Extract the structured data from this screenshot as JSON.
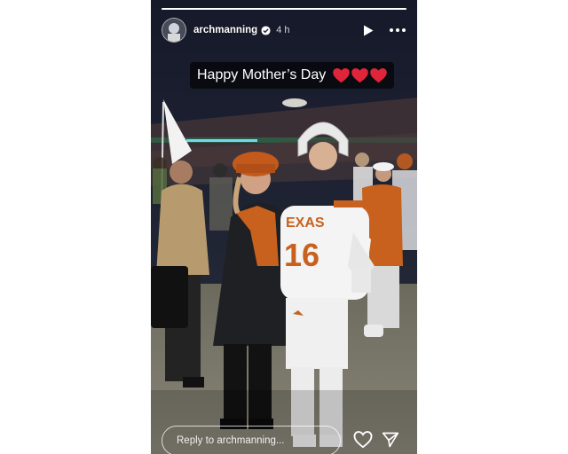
{
  "story": {
    "username": "archmanning",
    "time_ago": "4 h",
    "progress": 1.0,
    "caption": "Happy Mother’s Day",
    "heart_count": 3,
    "reply_placeholder": "Reply to archmanning...",
    "jersey_text": "EXAS",
    "jersey_number": "16"
  },
  "icons": {
    "verified": "verified-badge-icon",
    "play": "play-icon",
    "more": "more-options-icon",
    "heart": "heart-icon",
    "like": "like-heart-icon",
    "share": "send-icon"
  },
  "colors": {
    "texas_orange": "#c8601e",
    "heart_red": "#e0243a",
    "night_sky": "#1a1f2e"
  }
}
